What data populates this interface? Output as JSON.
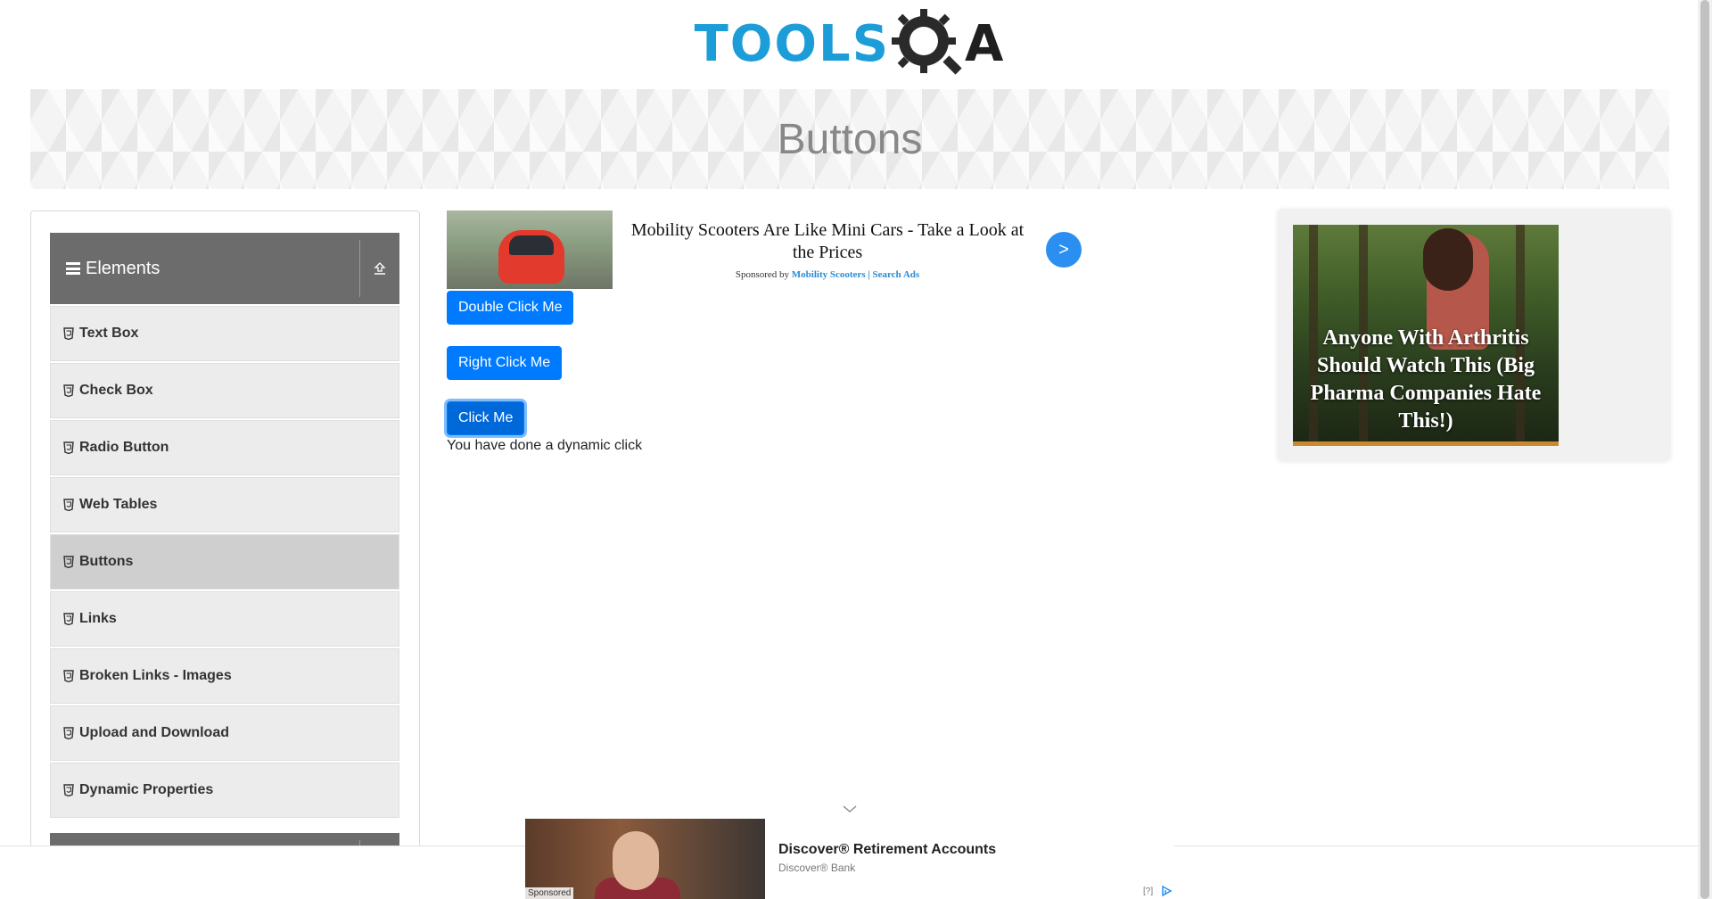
{
  "header": {
    "logo_tools": "TOOLS",
    "logo_a": "A"
  },
  "banner": {
    "title": "Buttons"
  },
  "sidebar": {
    "group_title": "Elements",
    "items": [
      {
        "label": "Text Box"
      },
      {
        "label": "Check Box"
      },
      {
        "label": "Radio Button"
      },
      {
        "label": "Web Tables"
      },
      {
        "label": "Buttons"
      },
      {
        "label": "Links"
      },
      {
        "label": "Broken Links - Images"
      },
      {
        "label": "Upload and Download"
      },
      {
        "label": "Dynamic Properties"
      }
    ],
    "active_item": "Buttons"
  },
  "main": {
    "double_click_label": "Double Click Me",
    "right_click_label": "Right Click Me",
    "click_label": "Click Me",
    "dynamic_click_message": "You have done a dynamic click"
  },
  "top_ad": {
    "headline": "Mobility Scooters Are Like Mini Cars - Take a Look at the Prices",
    "sponsored_by": "Sponsored by",
    "brand": "Mobility Scooters | Search Ads",
    "arrow": ">"
  },
  "right_ad": {
    "headline": "Anyone With Arthritis Should Watch This (Big Pharma Companies Hate This!)"
  },
  "bottom_ad": {
    "title": "Discover® Retirement Accounts",
    "brand": "Discover® Bank",
    "sponsored": "Sponsored",
    "help": "[?]"
  },
  "colors": {
    "primary_button": "#007bff",
    "logo_blue": "#1c9dd8",
    "sidebar_header": "#6c6c6c",
    "menu_item_bg": "#ececec",
    "menu_item_active": "#cfcfcf"
  },
  "icons": {
    "menu": "hamburger-icon",
    "collapse": "upload-arrow-icon",
    "menu_item": "html5-shield-icon",
    "ad_next": "chevron-right-icon",
    "bottom_expand": "chevron-down-icon",
    "ad_choices": "ad-choices-icon"
  }
}
